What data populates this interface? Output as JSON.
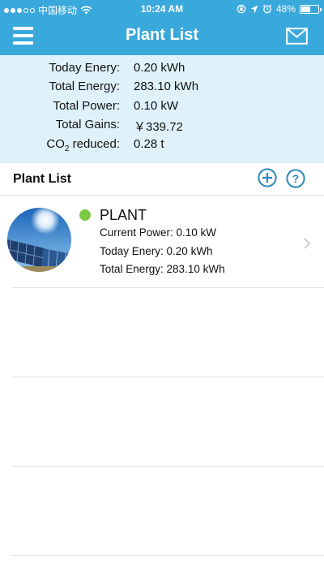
{
  "status_bar": {
    "carrier": "中国移动",
    "time": "10:24 AM",
    "battery_percent": "48%",
    "battery_level": 0.48,
    "icons": [
      "signal-dots-icon",
      "wifi-icon",
      "rotation-lock-icon",
      "location-icon",
      "alarm-icon",
      "battery-icon"
    ]
  },
  "nav": {
    "title": "Plant List",
    "menu_icon": "hamburger-menu-icon",
    "mail_icon": "mail-icon"
  },
  "summary": {
    "rows": [
      {
        "label": "Today Enery:",
        "value": "0.20 kWh"
      },
      {
        "label": "Total Energy:",
        "value": "283.10 kWh"
      },
      {
        "label": "Total Power:",
        "value": "0.10 kW"
      },
      {
        "label": "Total Gains:",
        "value": "￥339.72"
      },
      {
        "label_prefix": "CO",
        "label_sub": "2",
        "label_suffix": " reduced:",
        "value": "0.28 t"
      }
    ]
  },
  "list": {
    "title": "Plant List",
    "add_icon": "add-circle-icon",
    "help_icon": "help-circle-icon",
    "plants": [
      {
        "name": "PLANT",
        "status_color": "#7ac943",
        "current_power_label": "Current Power: 0.10 kW",
        "today_energy_label": "Today Enery: 0.20 kWh",
        "total_energy_label": "Total Energy: 283.10 kWh"
      }
    ]
  },
  "colors": {
    "header_bg": "#39a9dc",
    "summary_bg": "#dff1fa",
    "accent": "#2b8ab8",
    "status_online": "#7ac943"
  }
}
